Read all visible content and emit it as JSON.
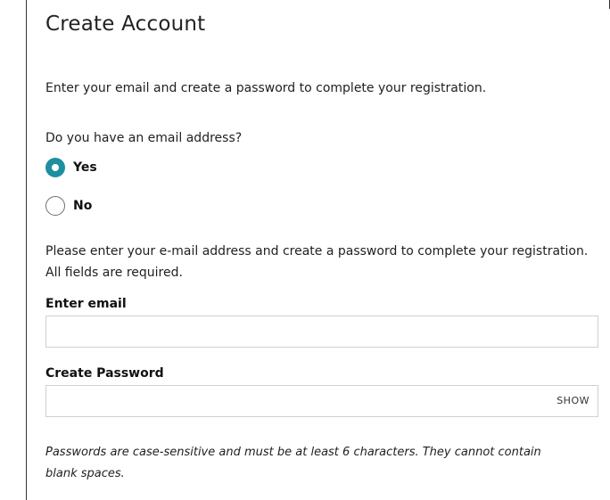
{
  "form": {
    "title": "Create Account",
    "intro": "Enter your email and create a password to complete your registration.",
    "question": "Do you have an email address?",
    "options": [
      {
        "label": "Yes",
        "checked": true
      },
      {
        "label": "No",
        "checked": false
      }
    ],
    "instructions_line1": "Please enter your e-mail address and create a password to complete your registration.",
    "instructions_line2": "All fields are required.",
    "email": {
      "label": "Enter email",
      "value": "",
      "placeholder": ""
    },
    "password": {
      "label": "Create Password",
      "value": "",
      "placeholder": "",
      "show_label": "SHOW"
    },
    "hint_line1": "Passwords are case-sensitive and must be at least 6 characters. They cannot contain",
    "hint_line2": "blank spaces."
  },
  "colors": {
    "radio_accent": "#1e8fa0",
    "input_border": "#d0d0d0"
  }
}
